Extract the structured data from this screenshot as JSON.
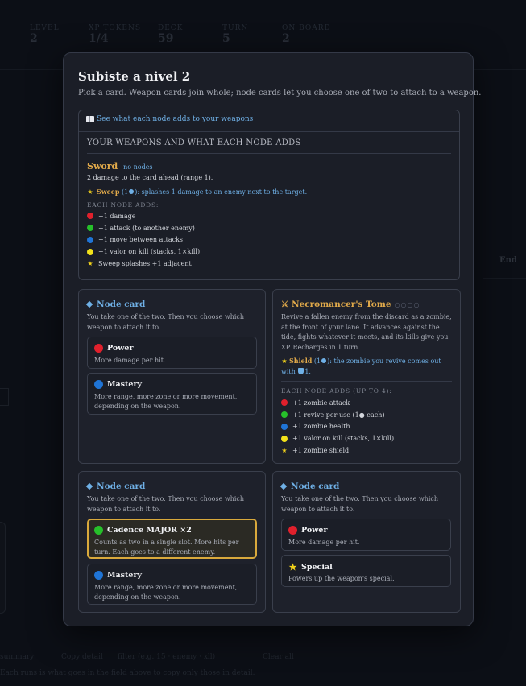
{
  "background": {
    "stats": [
      {
        "label": "LEVEL",
        "value": "2"
      },
      {
        "label": "XP TOKENS",
        "value": "1/4"
      },
      {
        "label": "DECK",
        "value": "59"
      },
      {
        "label": "TURN",
        "value": "5"
      },
      {
        "label": "ON BOARD",
        "value": "2"
      }
    ],
    "end_label": "End",
    "bottom_summary": "summary",
    "bottom_copy": "Copy detail",
    "bottom_filter_placeholder": "filter (e.g. 15 · enemy · xll)",
    "bottom_clear": "Clear all",
    "bottom_hint": "Each runs is what goes in the field above to copy only those in detail."
  },
  "modal": {
    "title": "Subiste a nivel 2",
    "subtitle": "Pick a card. Weapon cards join whole; node cards let you choose one of two to attach to a weapon.",
    "weapons_toggle": "See what each node adds to your weapons",
    "weapons_heading": "YOUR WEAPONS AND WHAT EACH NODE ADDS",
    "weapon": {
      "name": "Sword",
      "nodes_label": "no nodes",
      "description": "2 damage to the card ahead (range 1).",
      "special_name": "Sweep",
      "special_cost": "(1",
      "special_cost_end": "):",
      "special_text": "splashes 1 damage to an enemy next to the target.",
      "each_node_heading": "EACH NODE ADDS:",
      "node_adds": [
        {
          "color": "red",
          "text": "+1 damage"
        },
        {
          "color": "green",
          "text": "+1 attack (to another enemy)"
        },
        {
          "color": "blue",
          "text": "+1 move between attacks"
        },
        {
          "color": "yellow",
          "text": "+1 valor on kill (stacks, 1×kill)"
        },
        {
          "color": "star",
          "text": "Sweep splashes +1 adjacent"
        }
      ]
    },
    "cards": [
      {
        "type": "node",
        "title": "Node card",
        "description": "You take one of the two. Then you choose which weapon to attach it to.",
        "options": [
          {
            "color": "red",
            "name": "Power",
            "description": "More damage per hit.",
            "selected": false
          },
          {
            "color": "blue",
            "name": "Mastery",
            "description": "More range, more zone or more movement, depending on the weapon.",
            "selected": false
          }
        ]
      },
      {
        "type": "weapon",
        "title": "Necromancer's Tome",
        "pips": "○○○○",
        "description": "Revive a fallen enemy from the discard as a zombie, at the front of your lane. It advances against the tide, fights whatever it meets, and its kills give you XP. Recharges in 1 turn.",
        "special_name": "Shield",
        "special_cost": "(1",
        "special_cost_end": "):",
        "special_text": "the zombie you revive comes out with",
        "special_value": "1.",
        "each_node_heading": "EACH NODE ADDS (UP TO 4):",
        "node_adds": [
          {
            "color": "red",
            "text": "+1 zombie attack"
          },
          {
            "color": "green",
            "text": "+1 revive per use (1● each)"
          },
          {
            "color": "blue",
            "text": "+1 zombie health"
          },
          {
            "color": "yellow",
            "text": "+1 valor on kill (stacks, 1×kill)"
          },
          {
            "color": "star",
            "text": "+1 zombie shield"
          }
        ]
      },
      {
        "type": "node",
        "title": "Node card",
        "description": "You take one of the two. Then you choose which weapon to attach it to.",
        "options": [
          {
            "color": "green",
            "name": "Cadence MAJOR ×2",
            "description": "Counts as two in a single slot. More hits per turn. Each goes to a different enemy.",
            "selected": true
          },
          {
            "color": "blue",
            "name": "Mastery",
            "description": "More range, more zone or more movement, depending on the weapon.",
            "selected": false
          }
        ]
      },
      {
        "type": "node",
        "title": "Node card",
        "description": "You take one of the two. Then you choose which weapon to attach it to.",
        "options": [
          {
            "color": "red",
            "name": "Power",
            "description": "More damage per hit.",
            "selected": false
          },
          {
            "color": "star",
            "name": "Special",
            "description": "Powers up the weapon's special.",
            "selected": false
          }
        ]
      }
    ]
  }
}
